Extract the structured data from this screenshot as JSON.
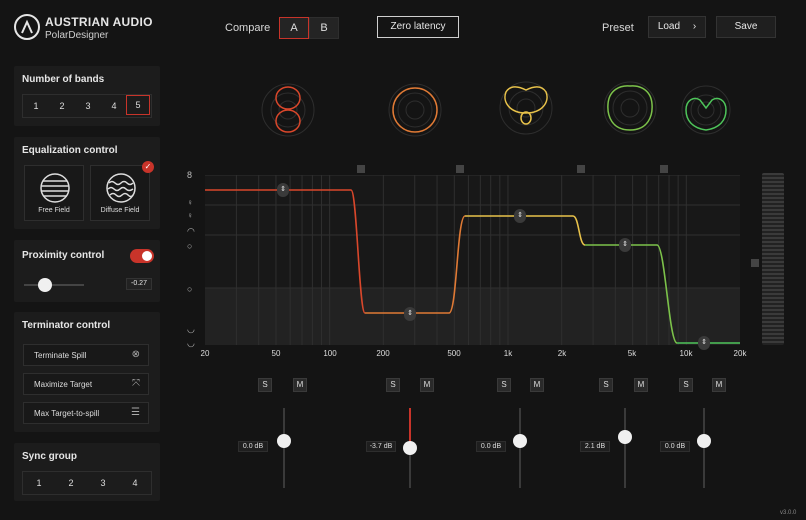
{
  "header": {
    "brand_line1": "AUSTRIAN AUDIO",
    "brand_line2": "PolarDesigner",
    "compare_label": "Compare",
    "compare_a": "A",
    "compare_b": "B",
    "zero_latency": "Zero latency",
    "preset_label": "Preset",
    "load_label": "Load",
    "load_icon": "chevron-right-icon",
    "save_label": "Save"
  },
  "bands_panel": {
    "title": "Number of bands",
    "options": [
      "1",
      "2",
      "3",
      "4",
      "5"
    ],
    "selected": "5"
  },
  "eq_panel": {
    "title": "Equalization control",
    "free_field": "Free Field",
    "diffuse_field": "Diffuse Field",
    "selected": "Diffuse Field"
  },
  "proximity_panel": {
    "title": "Proximity control",
    "toggle_on": true,
    "value": "-0.27",
    "level": 0.35
  },
  "terminator_panel": {
    "title": "Terminator control",
    "items": [
      {
        "label": "Terminate Spill",
        "icon": "circle-x-icon"
      },
      {
        "label": "Maximize Target",
        "icon": "expand-arrows-icon"
      },
      {
        "label": "Max Target-to-spill",
        "icon": "list-sort-icon"
      }
    ]
  },
  "sync_panel": {
    "title": "Sync group",
    "options": [
      "1",
      "2",
      "3",
      "4"
    ]
  },
  "graph": {
    "x_ticks": [
      "20",
      "50",
      "100",
      "200",
      "500",
      "1k",
      "2k",
      "5k",
      "10k",
      "20k"
    ],
    "band_colors": [
      "#d9472b",
      "#e07a35",
      "#e8c24a",
      "#7cc24a",
      "#4ec45a"
    ]
  },
  "bands": [
    {
      "solo": "S",
      "mute": "M",
      "gain": "0.0 dB",
      "gain_level": 0.5
    },
    {
      "solo": "S",
      "mute": "M",
      "gain": "-3.7 dB",
      "gain_level": 0.45
    },
    {
      "solo": "S",
      "mute": "M",
      "gain": "0.0 dB",
      "gain_level": 0.5
    },
    {
      "solo": "S",
      "mute": "M",
      "gain": "2.1 dB",
      "gain_level": 0.53
    },
    {
      "solo": "S",
      "mute": "M",
      "gain": "0.0 dB",
      "gain_level": 0.5
    }
  ],
  "footer": {
    "version": "v3.0.0"
  }
}
